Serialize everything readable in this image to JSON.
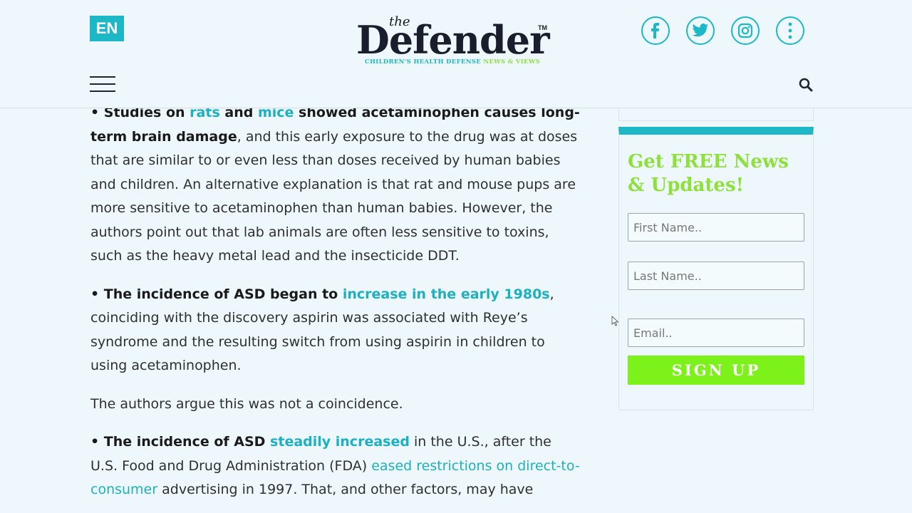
{
  "header": {
    "lang": "EN",
    "logo": {
      "the": "the",
      "name": "Defender",
      "tm": "TM",
      "tagline_a": "CHILDREN'S HEALTH DEFENSE",
      "tagline_b": "NEWS & VIEWS"
    },
    "social": [
      {
        "icon": "facebook-icon"
      },
      {
        "icon": "twitter-icon"
      },
      {
        "icon": "instagram-icon"
      },
      {
        "icon": "more-vertical-icon"
      }
    ],
    "menu_icon": "hamburger-menu-icon",
    "search_icon": "search-icon"
  },
  "article": {
    "p1": {
      "b1": "• Studies on ",
      "link_rats": "rats",
      "b2": " and ",
      "link_mice": "mice",
      "b3": " showed acetaminophen causes long-term brain damage",
      "rest": ", and this early exposure to the drug was at doses that are similar to or even less than doses received by human babies and children. An alternative explanation is that rat and mouse pups are more sensitive to acetaminophen than human babies. However, the authors point out that lab animals are often less sensitive to toxins, such as the heavy metal lead and the insecticide DDT."
    },
    "p2": {
      "b1": "• The incidence of ASD began to ",
      "link": "increase in the early 1980s",
      "rest": ", coinciding with the discovery aspirin was associated with Reye’s syndrome and the resulting switch from using aspirin in children to using acetaminophen."
    },
    "p3": "The authors argue this was not a coincidence.",
    "p4": {
      "b1": "• The incidence of ASD ",
      "link1": "steadily increased",
      "mid": " in the U.S., after the U.S. Food and Drug Administration (FDA) ",
      "link2": "eased restrictions on direct-to-consumer",
      "rest": " advertising in 1997. That, and other factors, may have"
    }
  },
  "signup": {
    "title": "Get FREE News & Updates!",
    "first_name_placeholder": "First Name..",
    "last_name_placeholder": "Last Name..",
    "email_placeholder": "Email..",
    "button": "SIGN UP"
  },
  "colors": {
    "accent": "#1cb8c8",
    "green": "#8ee03a",
    "button_green": "#7cf21a",
    "background": "#eef8fc"
  }
}
